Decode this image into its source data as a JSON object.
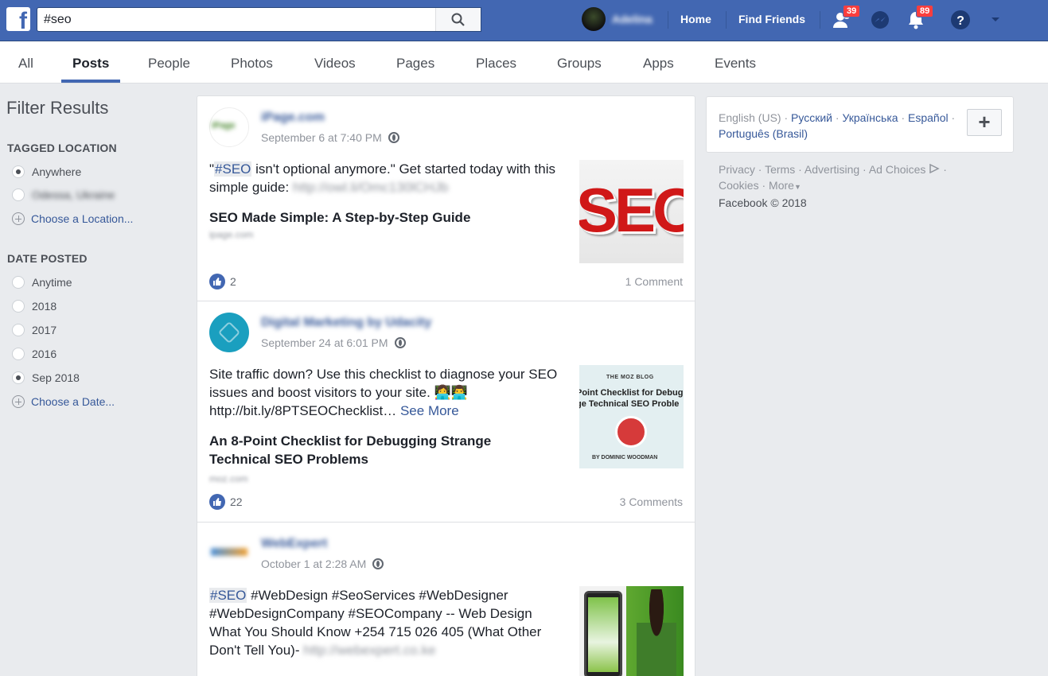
{
  "topbar": {
    "search_value": "#seo",
    "user_name": "Adelina",
    "home": "Home",
    "find_friends": "Find Friends",
    "friend_requests_count": "39",
    "notifications_count": "89"
  },
  "tabs": [
    "All",
    "Posts",
    "People",
    "Photos",
    "Videos",
    "Pages",
    "Places",
    "Groups",
    "Apps",
    "Events"
  ],
  "filter": {
    "title": "Filter Results",
    "tagged_location": {
      "heading": "TAGGED LOCATION",
      "options": [
        "Anywhere",
        "Odessa, Ukraine"
      ],
      "choose": "Choose a Location..."
    },
    "date_posted": {
      "heading": "DATE POSTED",
      "options": [
        "Anytime",
        "2018",
        "2017",
        "2016",
        "Sep 2018"
      ],
      "choose": "Choose a Date..."
    }
  },
  "posts": [
    {
      "name": "iPage.com",
      "time": "September 6 at 7:40 PM",
      "text_before": "\"",
      "hashtag": "#SEO",
      "text_after": " isn't optional anymore.\" Get started today with this simple guide: ",
      "blurred_link": "http://owl.li/Omc130lCHJb",
      "title": "SEO Made Simple: A Step-by-Step Guide",
      "domain": "ipage.com",
      "likes": "2",
      "comments": "1 Comment",
      "thumb_text": "SEO"
    },
    {
      "name": "Digital Marketing by Udacity",
      "time": "September 24 at 6:01 PM",
      "text": "Site traffic down? Use this checklist to diagnose your SEO issues and boost visitors to your site. 👩‍💻👨‍💻 http://bit.ly/8PTSEOChecklist… ",
      "see_more": "See More",
      "title": "An 8-Point Checklist for Debugging Strange Technical SEO Problems",
      "domain": "moz.com",
      "likes": "22",
      "comments": "3 Comments",
      "thumb_top": "THE MOZ BLOG",
      "thumb_title": "Point Checklist for Debug ge Technical SEO Proble",
      "thumb_author": "BY DOMINIC WOODMAN"
    },
    {
      "name": "WebExpert",
      "time": "October 1 at 2:28 AM",
      "hashtag": "#SEO",
      "text_after": " #WebDesign #SeoServices #WebDesigner #WebDesignCompany #SEOCompany -- Web Design What You Should Know +254 715 026 405 (What Other Don't Tell You)- ",
      "blurred_link": "http://webexpert.co.ke"
    }
  ],
  "right": {
    "lang_current": "English (US)",
    "languages": [
      "Русский",
      "Українська",
      "Español",
      "Português (Brasil)"
    ],
    "footer": [
      "Privacy",
      "Terms",
      "Advertising",
      "Ad Choices",
      "Cookies",
      "More"
    ],
    "copyright": "Facebook © 2018"
  },
  "colors": {
    "brand": "#4267b2",
    "link": "#365899",
    "badge": "#fa3e3e"
  }
}
